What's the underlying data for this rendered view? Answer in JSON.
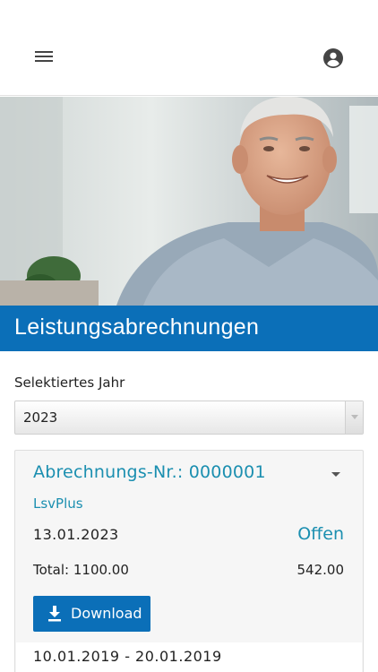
{
  "header": {
    "menu_icon": "hamburger-menu-icon",
    "account_icon": "account-circle-icon"
  },
  "hero": {
    "image": "smiling-senior-man-photo"
  },
  "page": {
    "title": "Leistungsabrechnungen"
  },
  "filter": {
    "year_label": "Selektiertes Jahr",
    "selected_year": "2023"
  },
  "invoice": {
    "number_label": "Abrechnungs-Nr.: 0000001",
    "provider": "LsvPlus",
    "date": "13.01.2023",
    "status": "Offen",
    "total_label": "Total: 1100.00",
    "open_amount": "542.00",
    "download_label": "Download",
    "download_icon": "download-icon",
    "period": "10.01.2019 - 20.01.2019",
    "period_detail": ""
  },
  "colors": {
    "primary": "#0b6fb8",
    "accent_text": "#1b8fb0"
  }
}
